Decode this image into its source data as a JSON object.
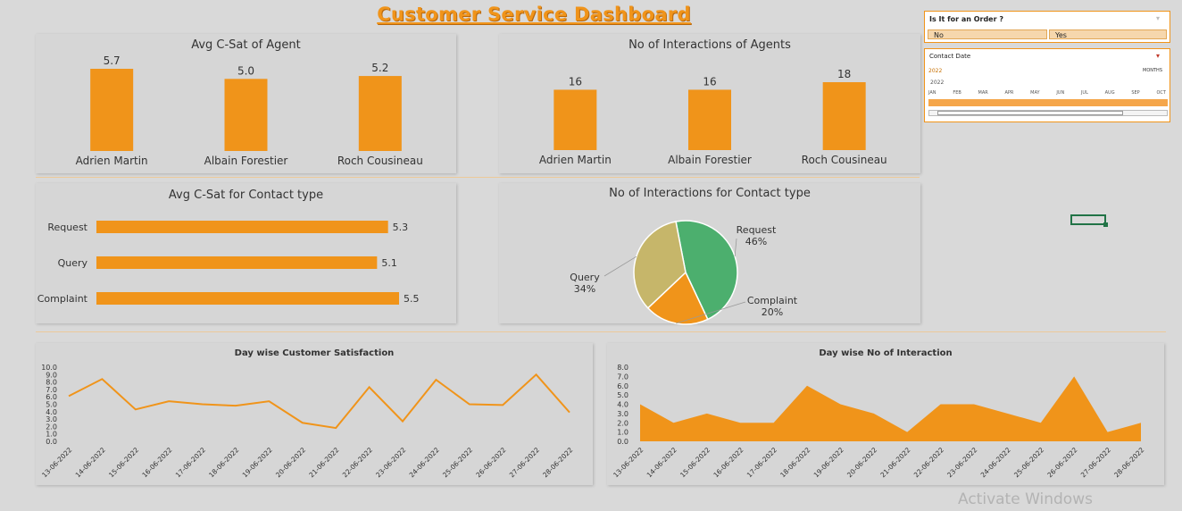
{
  "dashboard": {
    "title": "Customer Service Dashboard"
  },
  "colors": {
    "accent": "#f0941a",
    "query": "#c6b66a",
    "request": "#4caf6e",
    "complaint": "#f0941a"
  },
  "slicers": {
    "order": {
      "title": "Is It for an Order ?",
      "options": [
        "No",
        "Yes"
      ]
    },
    "contact_date": {
      "title": "Contact Date",
      "selected_label": "2022",
      "level_label": "MONTHS",
      "year": "2022",
      "months": [
        "JAN",
        "FEB",
        "MAR",
        "APR",
        "MAY",
        "JUN",
        "JUL",
        "AUG",
        "SEP",
        "OCT"
      ]
    }
  },
  "watermark": "Activate Windows",
  "chart_data": [
    {
      "type": "bar",
      "title": "Avg C-Sat of Agent",
      "categories": [
        "Adrien Martin",
        "Albain Forestier",
        "Roch Cousineau"
      ],
      "values": [
        5.7,
        5.0,
        5.2
      ],
      "labels": [
        "5.7",
        "5.0",
        "5.2"
      ]
    },
    {
      "type": "bar",
      "title": "No of Interactions of Agents",
      "categories": [
        "Adrien Martin",
        "Albain Forestier",
        "Roch Cousineau"
      ],
      "values": [
        16,
        16,
        18
      ],
      "labels": [
        "16",
        "16",
        "18"
      ]
    },
    {
      "type": "bar",
      "orientation": "horizontal",
      "title": "Avg C-Sat for Contact type",
      "categories": [
        "Request",
        "Query",
        "Complaint"
      ],
      "values": [
        5.3,
        5.1,
        5.5
      ],
      "labels": [
        "5.3",
        "5.1",
        "5.5"
      ]
    },
    {
      "type": "pie",
      "title": "No of Interactions for Contact type",
      "slices": [
        {
          "label": "Request",
          "value": 46,
          "pct": "46%"
        },
        {
          "label": "Complaint",
          "value": 20,
          "pct": "20%"
        },
        {
          "label": "Query",
          "value": 34,
          "pct": "34%"
        }
      ]
    },
    {
      "type": "line",
      "title": "Day wise Customer Satisfaction",
      "x": [
        "13-06-2022",
        "14-06-2022",
        "15-06-2022",
        "16-06-2022",
        "17-06-2022",
        "18-06-2022",
        "19-06-2022",
        "20-06-2022",
        "21-06-2022",
        "22-06-2022",
        "23-06-2022",
        "24-06-2022",
        "25-06-2022",
        "26-06-2022",
        "27-06-2022",
        "28-06-2022"
      ],
      "values": [
        6.1,
        8.4,
        4.3,
        5.4,
        5.0,
        4.8,
        5.4,
        2.5,
        1.8,
        7.3,
        2.7,
        8.3,
        5.0,
        4.9,
        9.0,
        3.9
      ],
      "ylim": [
        0,
        10
      ],
      "yticks": [
        "0.0",
        "1.0",
        "2.0",
        "3.0",
        "4.0",
        "5.0",
        "6.0",
        "7.0",
        "8.0",
        "9.0",
        "10.0"
      ]
    },
    {
      "type": "area",
      "title": "Day wise No of Interaction",
      "x": [
        "13-06-2022",
        "14-06-2022",
        "15-06-2022",
        "16-06-2022",
        "17-06-2022",
        "18-06-2022",
        "19-06-2022",
        "20-06-2022",
        "21-06-2022",
        "22-06-2022",
        "23-06-2022",
        "24-06-2022",
        "25-06-2022",
        "26-06-2022",
        "27-06-2022",
        "28-06-2022"
      ],
      "values": [
        4,
        2,
        3,
        2,
        2,
        6,
        4,
        3,
        1,
        4,
        4,
        3,
        2,
        7,
        1,
        2
      ],
      "ylim": [
        0,
        8
      ],
      "yticks": [
        "0.0",
        "1.0",
        "2.0",
        "3.0",
        "4.0",
        "5.0",
        "6.0",
        "7.0",
        "8.0"
      ]
    }
  ]
}
